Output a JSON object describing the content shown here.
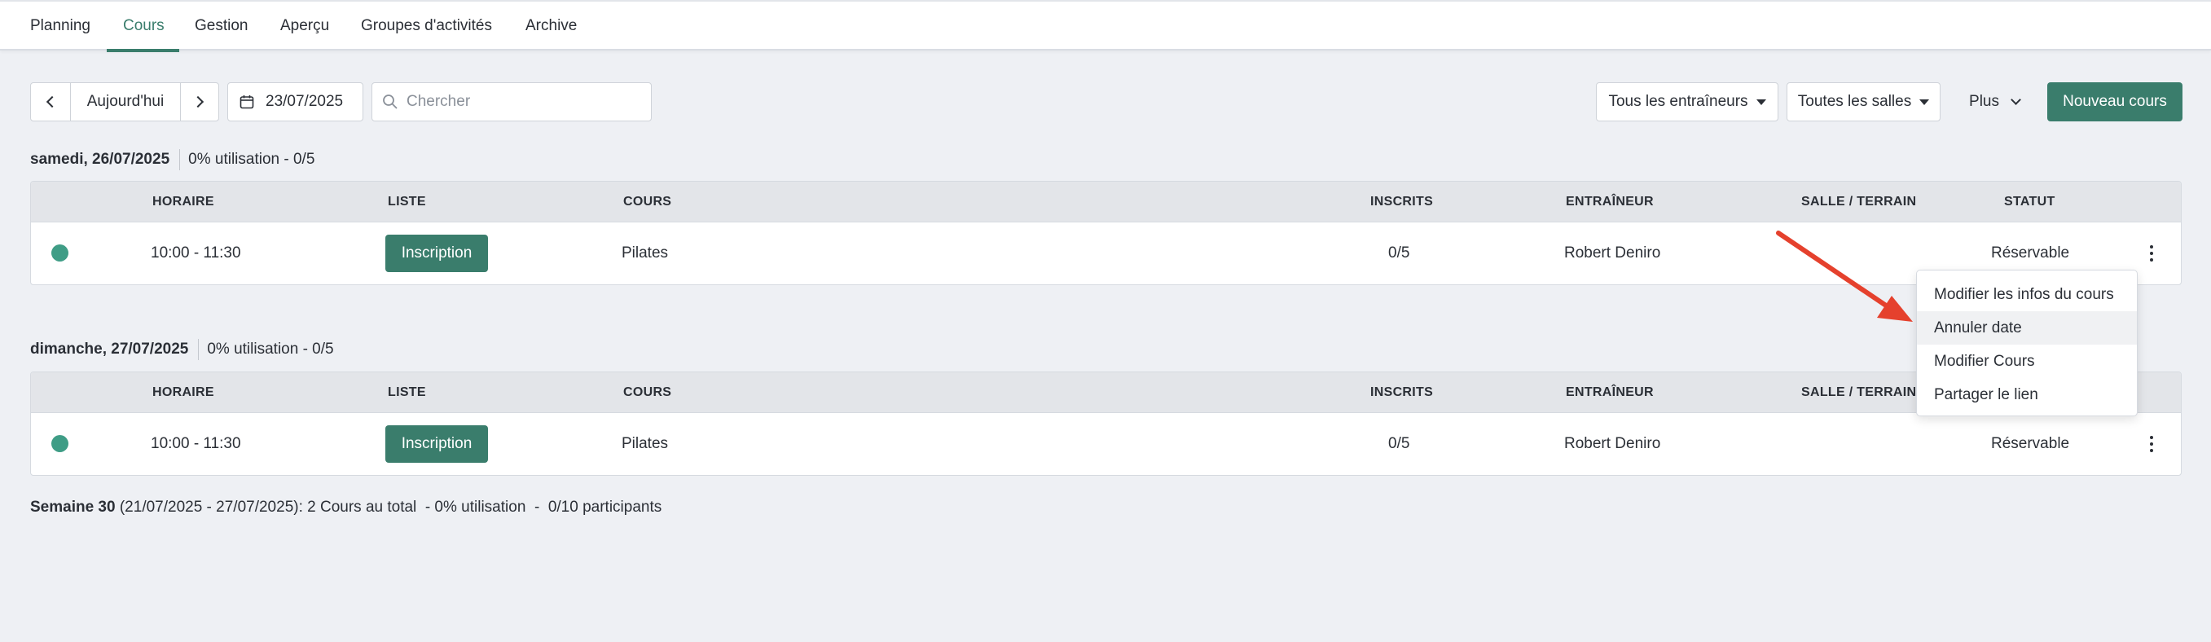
{
  "nav": {
    "tabs": [
      {
        "label": "Planning"
      },
      {
        "label": "Cours"
      },
      {
        "label": "Gestion"
      },
      {
        "label": "Aperçu"
      },
      {
        "label": "Groupes d'activités"
      },
      {
        "label": "Archive"
      }
    ],
    "active_tab": "Cours"
  },
  "toolbar": {
    "today_label": "Aujourd'hui",
    "date_value": "23/07/2025",
    "search_placeholder": "Chercher",
    "trainers_label": "Tous les entraîneurs",
    "rooms_label": "Toutes les salles",
    "more_label": "Plus",
    "new_course_label": "Nouveau cours"
  },
  "table_headers": {
    "horaire": "HORAIRE",
    "liste": "LISTE",
    "cours": "COURS",
    "inscrits": "INSCRITS",
    "entraineur": "ENTRAÎNEUR",
    "salle": "SALLE / TERRAIN",
    "statut": "STATUT"
  },
  "days": [
    {
      "date": "samedi, 26/07/2025",
      "utilization": "0% utilisation - 0/5",
      "rows": [
        {
          "time": "10:00 - 11:30",
          "list_button": "Inscription",
          "course": "Pilates",
          "enrolled": "0/5",
          "trainer": "Robert Deniro",
          "room": "",
          "status": "Réservable"
        }
      ]
    },
    {
      "date": "dimanche, 27/07/2025",
      "utilization": "0% utilisation - 0/5",
      "rows": [
        {
          "time": "10:00 - 11:30",
          "list_button": "Inscription",
          "course": "Pilates",
          "enrolled": "0/5",
          "trainer": "Robert Deniro",
          "room": "",
          "status": "Réservable"
        }
      ]
    }
  ],
  "footer": {
    "week": "Semaine 30",
    "summary": " (21/07/2025 - 27/07/2025): 2 Cours au total  - 0% utilisation  -  0/10 participants"
  },
  "context_menu": {
    "items": [
      {
        "label": "Modifier les infos du cours"
      },
      {
        "label": "Annuler date"
      },
      {
        "label": "Modifier Cours"
      },
      {
        "label": "Partager le lien"
      }
    ],
    "highlighted_index": 1
  },
  "colors": {
    "accent": "#3a7d6c",
    "status_dot": "#3f9d86",
    "annotation_arrow": "#e5412d",
    "background": "#eef0f4"
  },
  "icons": {
    "prev": "chevron-left-icon",
    "next": "chevron-right-icon",
    "calendar": "calendar-icon",
    "search": "search-icon",
    "dropdown": "caret-down-icon",
    "more_chevron": "chevron-down-icon",
    "row_menu": "kebab-menu-icon",
    "status": "status-dot-icon",
    "annotation": "red-arrow-annotation"
  }
}
